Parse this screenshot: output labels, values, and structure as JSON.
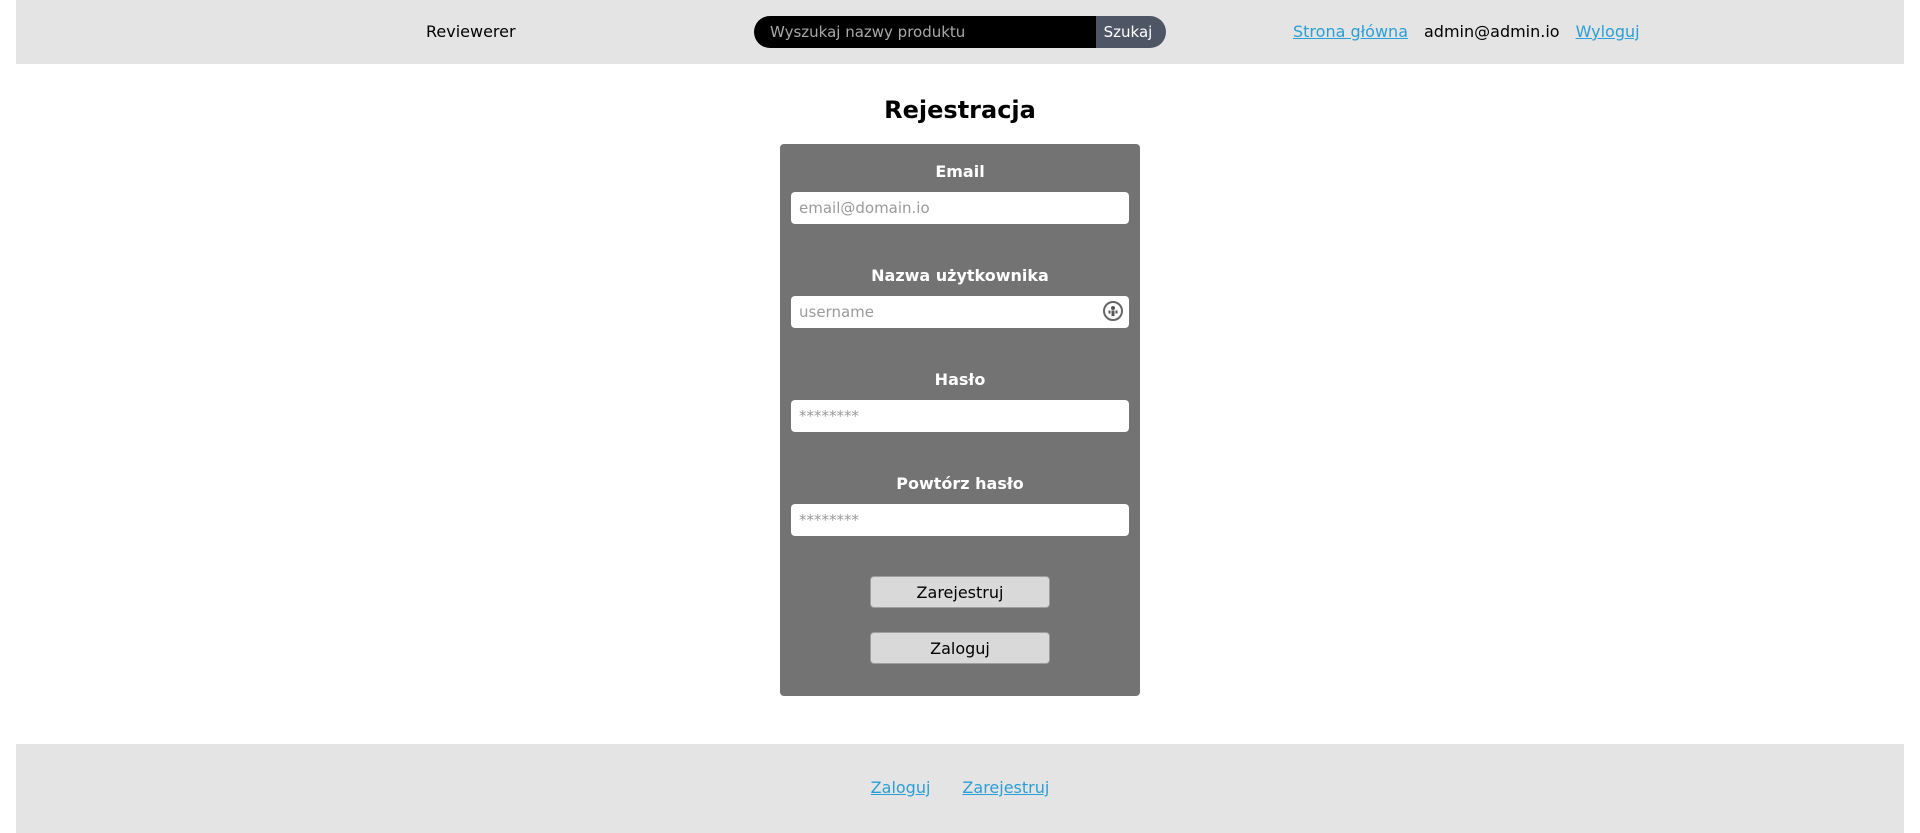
{
  "header": {
    "brand": "Reviewerer",
    "search": {
      "placeholder": "Wyszukaj nazwy produktu",
      "button_label": "Szukaj"
    },
    "nav": {
      "home_link": "Strona główna",
      "user_email": "admin@admin.io",
      "logout_link": "Wyloguj"
    }
  },
  "main": {
    "title": "Rejestracja",
    "form": {
      "email_label": "Email",
      "email_placeholder": "email@domain.io",
      "username_label": "Nazwa użytkownika",
      "username_placeholder": "username",
      "password_label": "Hasło",
      "password_placeholder": "********",
      "repeat_password_label": "Powtórz hasło",
      "repeat_password_placeholder": "********",
      "register_button": "Zarejestruj",
      "login_button": "Zaloguj"
    }
  },
  "footer": {
    "login_link": "Zaloguj",
    "register_link": "Zarejestruj"
  },
  "colors": {
    "header_bg": "#e4e4e4",
    "card_bg": "#737373",
    "link": "#2a9fd6",
    "search_button_bg": "#4e5665"
  },
  "icons": {
    "username_field_badge": "user-badge-icon"
  }
}
